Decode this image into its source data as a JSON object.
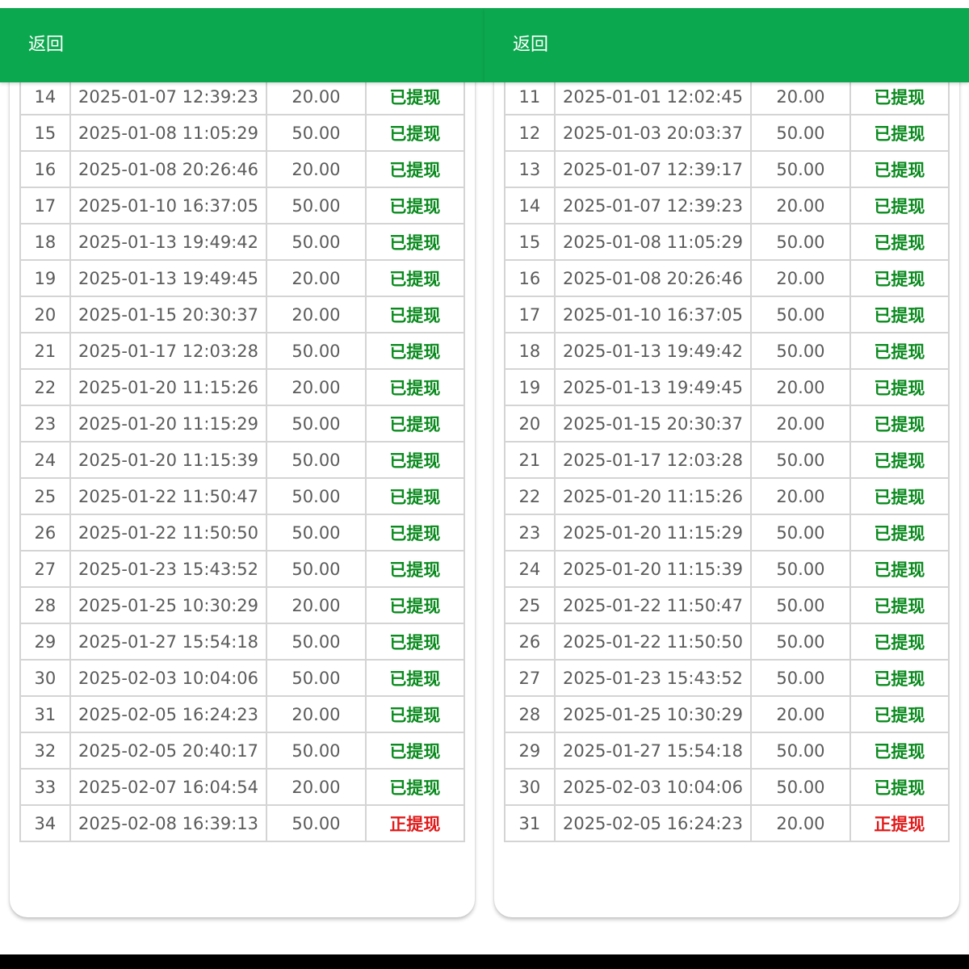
{
  "panels": [
    {
      "back_label": "返回",
      "rows": [
        {
          "index": "14",
          "time": "2025-01-07 12:39:23",
          "amount": "20.00",
          "status": "已提现"
        },
        {
          "index": "15",
          "time": "2025-01-08 11:05:29",
          "amount": "50.00",
          "status": "已提现"
        },
        {
          "index": "16",
          "time": "2025-01-08 20:26:46",
          "amount": "20.00",
          "status": "已提现"
        },
        {
          "index": "17",
          "time": "2025-01-10 16:37:05",
          "amount": "50.00",
          "status": "已提现"
        },
        {
          "index": "18",
          "time": "2025-01-13 19:49:42",
          "amount": "50.00",
          "status": "已提现"
        },
        {
          "index": "19",
          "time": "2025-01-13 19:49:45",
          "amount": "20.00",
          "status": "已提现"
        },
        {
          "index": "20",
          "time": "2025-01-15 20:30:37",
          "amount": "20.00",
          "status": "已提现"
        },
        {
          "index": "21",
          "time": "2025-01-17 12:03:28",
          "amount": "50.00",
          "status": "已提现"
        },
        {
          "index": "22",
          "time": "2025-01-20 11:15:26",
          "amount": "20.00",
          "status": "已提现"
        },
        {
          "index": "23",
          "time": "2025-01-20 11:15:29",
          "amount": "50.00",
          "status": "已提现"
        },
        {
          "index": "24",
          "time": "2025-01-20 11:15:39",
          "amount": "50.00",
          "status": "已提现"
        },
        {
          "index": "25",
          "time": "2025-01-22 11:50:47",
          "amount": "50.00",
          "status": "已提现"
        },
        {
          "index": "26",
          "time": "2025-01-22 11:50:50",
          "amount": "50.00",
          "status": "已提现"
        },
        {
          "index": "27",
          "time": "2025-01-23 15:43:52",
          "amount": "50.00",
          "status": "已提现"
        },
        {
          "index": "28",
          "time": "2025-01-25 10:30:29",
          "amount": "20.00",
          "status": "已提现"
        },
        {
          "index": "29",
          "time": "2025-01-27 15:54:18",
          "amount": "50.00",
          "status": "已提现"
        },
        {
          "index": "30",
          "time": "2025-02-03 10:04:06",
          "amount": "50.00",
          "status": "已提现"
        },
        {
          "index": "31",
          "time": "2025-02-05 16:24:23",
          "amount": "20.00",
          "status": "已提现"
        },
        {
          "index": "32",
          "time": "2025-02-05 20:40:17",
          "amount": "50.00",
          "status": "已提现"
        },
        {
          "index": "33",
          "time": "2025-02-07 16:04:54",
          "amount": "20.00",
          "status": "已提现"
        },
        {
          "index": "34",
          "time": "2025-02-08 16:39:13",
          "amount": "50.00",
          "status": "正提现"
        }
      ]
    },
    {
      "back_label": "返回",
      "rows": [
        {
          "index": "11",
          "time": "2025-01-01 12:02:45",
          "amount": "20.00",
          "status": "已提现"
        },
        {
          "index": "12",
          "time": "2025-01-03 20:03:37",
          "amount": "50.00",
          "status": "已提现"
        },
        {
          "index": "13",
          "time": "2025-01-07 12:39:17",
          "amount": "50.00",
          "status": "已提现"
        },
        {
          "index": "14",
          "time": "2025-01-07 12:39:23",
          "amount": "20.00",
          "status": "已提现"
        },
        {
          "index": "15",
          "time": "2025-01-08 11:05:29",
          "amount": "50.00",
          "status": "已提现"
        },
        {
          "index": "16",
          "time": "2025-01-08 20:26:46",
          "amount": "20.00",
          "status": "已提现"
        },
        {
          "index": "17",
          "time": "2025-01-10 16:37:05",
          "amount": "50.00",
          "status": "已提现"
        },
        {
          "index": "18",
          "time": "2025-01-13 19:49:42",
          "amount": "50.00",
          "status": "已提现"
        },
        {
          "index": "19",
          "time": "2025-01-13 19:49:45",
          "amount": "20.00",
          "status": "已提现"
        },
        {
          "index": "20",
          "time": "2025-01-15 20:30:37",
          "amount": "20.00",
          "status": "已提现"
        },
        {
          "index": "21",
          "time": "2025-01-17 12:03:28",
          "amount": "50.00",
          "status": "已提现"
        },
        {
          "index": "22",
          "time": "2025-01-20 11:15:26",
          "amount": "20.00",
          "status": "已提现"
        },
        {
          "index": "23",
          "time": "2025-01-20 11:15:29",
          "amount": "50.00",
          "status": "已提现"
        },
        {
          "index": "24",
          "time": "2025-01-20 11:15:39",
          "amount": "50.00",
          "status": "已提现"
        },
        {
          "index": "25",
          "time": "2025-01-22 11:50:47",
          "amount": "50.00",
          "status": "已提现"
        },
        {
          "index": "26",
          "time": "2025-01-22 11:50:50",
          "amount": "50.00",
          "status": "已提现"
        },
        {
          "index": "27",
          "time": "2025-01-23 15:43:52",
          "amount": "50.00",
          "status": "已提现"
        },
        {
          "index": "28",
          "time": "2025-01-25 10:30:29",
          "amount": "20.00",
          "status": "已提现"
        },
        {
          "index": "29",
          "time": "2025-01-27 15:54:18",
          "amount": "50.00",
          "status": "已提现"
        },
        {
          "index": "30",
          "time": "2025-02-03 10:04:06",
          "amount": "50.00",
          "status": "已提现"
        },
        {
          "index": "31",
          "time": "2025-02-05 16:24:23",
          "amount": "20.00",
          "status": "正提现"
        }
      ]
    }
  ],
  "colors": {
    "header": "#0ca84f",
    "status_done": "#0a8a1e",
    "status_pending": "#e01a1a"
  }
}
